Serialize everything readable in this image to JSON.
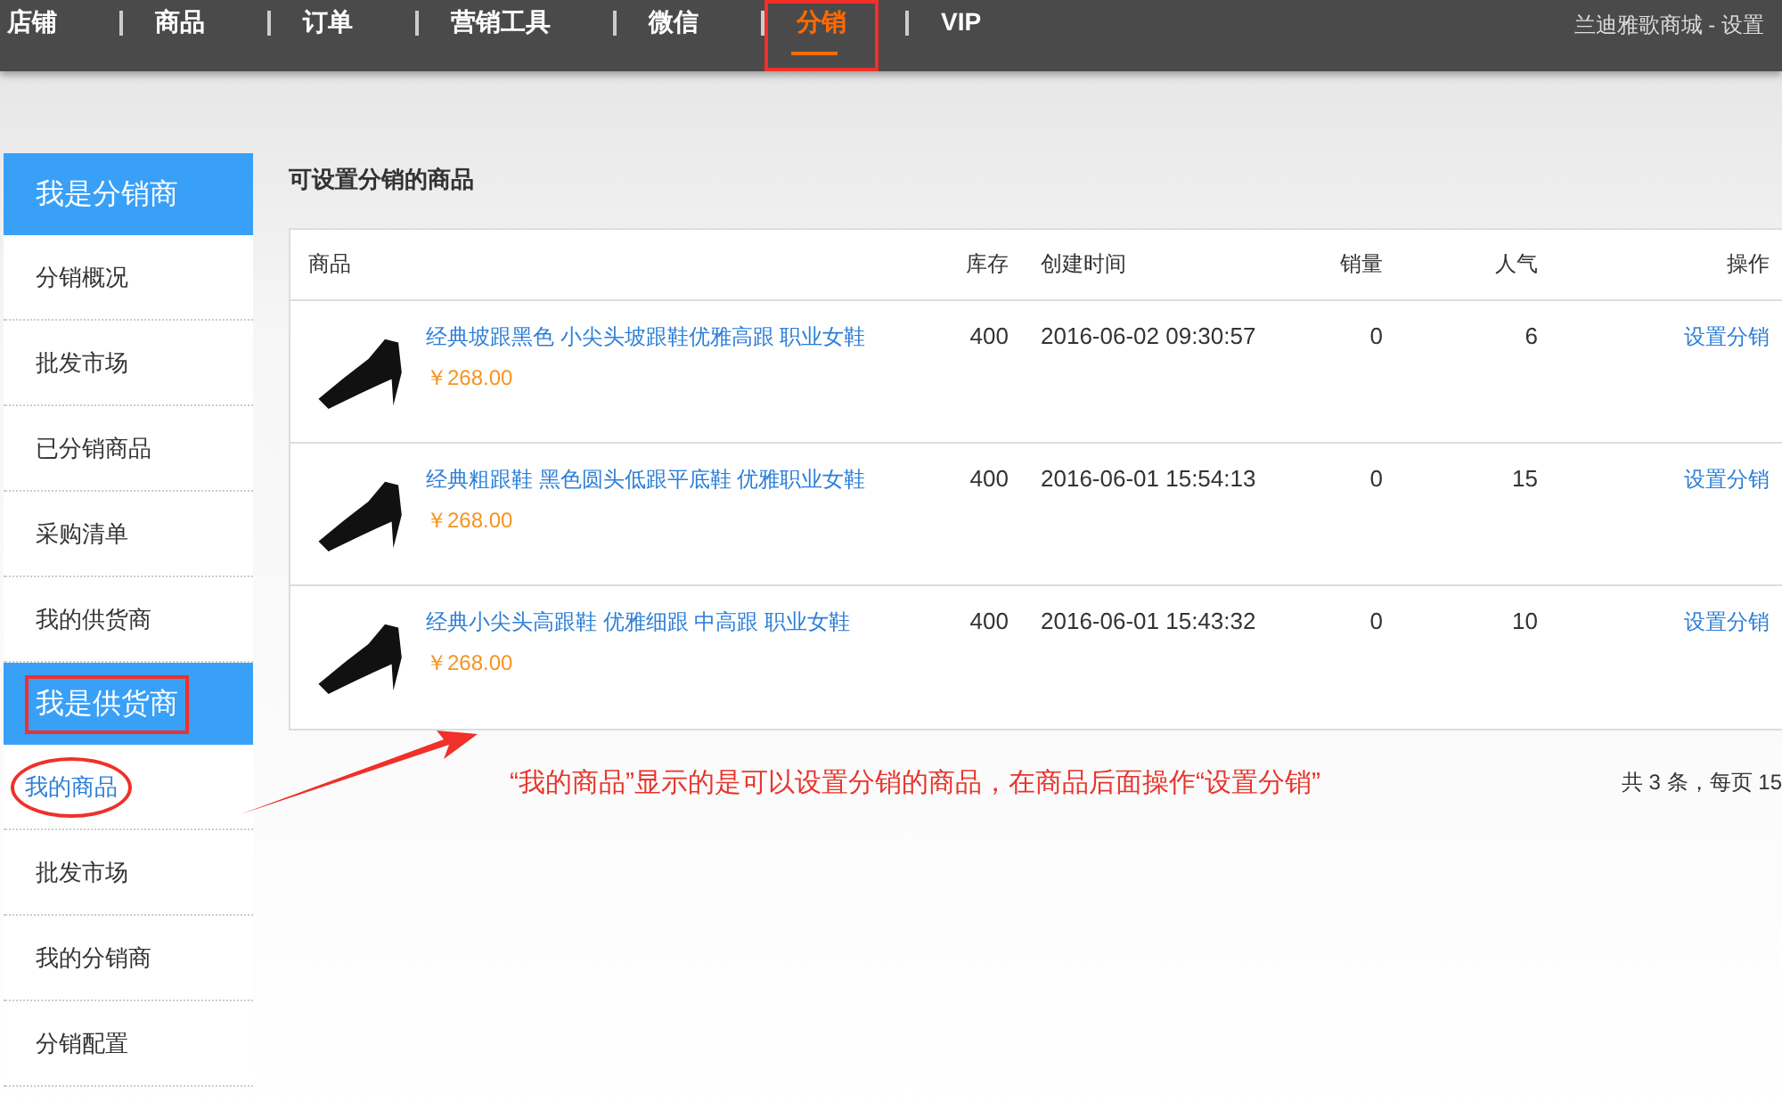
{
  "nav": {
    "items": [
      {
        "label": "店铺",
        "selected": false,
        "annotated": false
      },
      {
        "label": "商品",
        "selected": false,
        "annotated": false
      },
      {
        "label": "订单",
        "selected": false,
        "annotated": false
      },
      {
        "label": "营销工具",
        "selected": false,
        "annotated": false
      },
      {
        "label": "微信",
        "selected": false,
        "annotated": false
      },
      {
        "label": "分销",
        "selected": true,
        "annotated": true
      },
      {
        "label": "VIP",
        "selected": false,
        "annotated": false
      }
    ],
    "account": "兰迪雅歌商城 - 设置"
  },
  "sidebar": {
    "sections": [
      {
        "title": "我是分销商",
        "annotated": false,
        "items": [
          {
            "label": "分销概况",
            "selected": false,
            "annotated": false
          },
          {
            "label": "批发市场",
            "selected": false,
            "annotated": false
          },
          {
            "label": "已分销商品",
            "selected": false,
            "annotated": false
          },
          {
            "label": "采购清单",
            "selected": false,
            "annotated": false
          },
          {
            "label": "我的供货商",
            "selected": false,
            "annotated": false
          }
        ]
      },
      {
        "title": "我是供货商",
        "annotated": true,
        "items": [
          {
            "label": "我的商品",
            "selected": true,
            "annotated": true
          },
          {
            "label": "批发市场",
            "selected": false,
            "annotated": false
          },
          {
            "label": "我的分销商",
            "selected": false,
            "annotated": false
          },
          {
            "label": "分销配置",
            "selected": false,
            "annotated": false
          }
        ]
      }
    ]
  },
  "page_title": "可设置分销的商品",
  "table": {
    "columns": [
      "商品",
      "库存",
      "创建时间",
      "销量",
      "人气",
      "操作"
    ],
    "rows": [
      {
        "name": "经典坡跟黑色 小尖头坡跟鞋优雅高跟 职业女鞋",
        "price": "￥268.00",
        "stock": "400",
        "created": "2016-06-02 09:30:57",
        "sales": "0",
        "popularity": "6",
        "action": "设置分销"
      },
      {
        "name": "经典粗跟鞋 黑色圆头低跟平底鞋 优雅职业女鞋",
        "price": "￥268.00",
        "stock": "400",
        "created": "2016-06-01 15:54:13",
        "sales": "0",
        "popularity": "15",
        "action": "设置分销"
      },
      {
        "name": "经典小尖头高跟鞋 优雅细跟 中高跟 职业女鞋",
        "price": "￥268.00",
        "stock": "400",
        "created": "2016-06-01 15:43:32",
        "sales": "0",
        "popularity": "10",
        "action": "设置分销"
      }
    ]
  },
  "annotation_note": "“我的商品”显示的是可以设置分销的商品，在商品后面操作“设置分销”",
  "pagination": "共 3 条，每页 15"
}
